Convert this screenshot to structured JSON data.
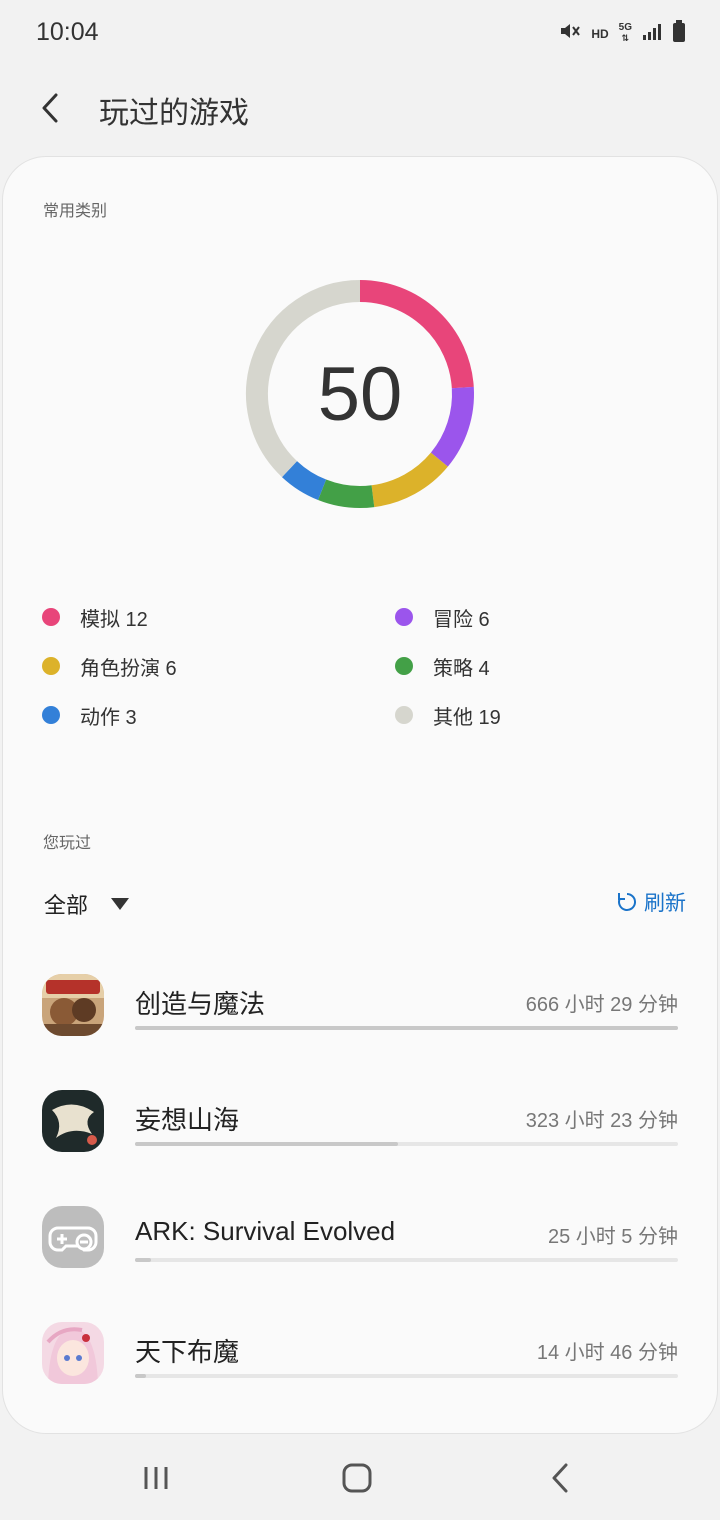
{
  "status_bar": {
    "time": "10:04",
    "hd": "HD",
    "network": "5G"
  },
  "header": {
    "title": "玩过的游戏"
  },
  "categories_section": {
    "label": "常用类别",
    "total": "50",
    "items": [
      {
        "name": "模拟",
        "count": 12,
        "color": "#e8457a"
      },
      {
        "name": "冒险",
        "count": 6,
        "color": "#9b55ec"
      },
      {
        "name": "角色扮演",
        "count": 6,
        "color": "#dcb22a"
      },
      {
        "name": "策略",
        "count": 4,
        "color": "#43a047"
      },
      {
        "name": "动作",
        "count": 3,
        "color": "#3380d8"
      },
      {
        "name": "其他",
        "count": 19,
        "color": "#d6d6ce"
      }
    ],
    "legend_text": [
      "模拟 12",
      "冒险 6",
      "角色扮演 6",
      "策略 4",
      "动作 3",
      "其他 19"
    ]
  },
  "played_section": {
    "label": "您玩过",
    "filter_label": "全部",
    "refresh_label": "刷新",
    "games": [
      {
        "name": "创造与魔法",
        "time": "666 小时 29 分钟",
        "progress": 1.0,
        "icon": "creation-magic-game-icon"
      },
      {
        "name": "妄想山海",
        "time": "323 小时 23 分钟",
        "progress": 0.485,
        "icon": "wangxiang-shanhai-game-icon"
      },
      {
        "name": "ARK: Survival Evolved",
        "time": "25 小时 5 分钟",
        "progress": 0.03,
        "icon": "gamepad-icon"
      },
      {
        "name": "天下布魔",
        "time": "14 小时 46 分钟",
        "progress": 0.02,
        "icon": "tianxia-bumo-game-icon"
      }
    ]
  }
}
